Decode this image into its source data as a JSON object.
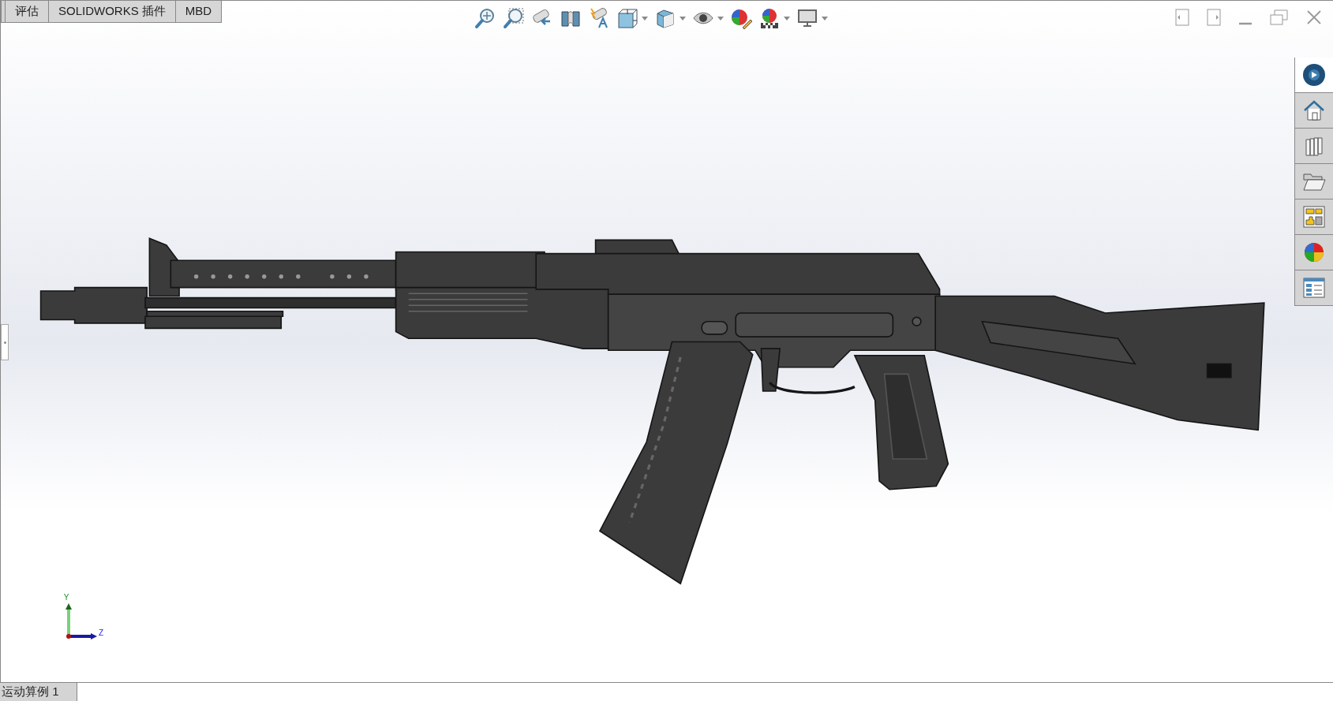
{
  "command_tabs": [
    {
      "label": "评估"
    },
    {
      "label": "SOLIDWORKS 插件"
    },
    {
      "label": "MBD"
    }
  ],
  "task_pane": {
    "tabs": [
      {
        "kind": "resources",
        "selected": true
      },
      {
        "kind": "home",
        "selected": false
      },
      {
        "kind": "library",
        "selected": false
      },
      {
        "kind": "folder",
        "selected": false
      },
      {
        "kind": "palette",
        "selected": false
      },
      {
        "kind": "appearance",
        "selected": false
      },
      {
        "kind": "properties",
        "selected": false
      }
    ]
  },
  "triad": {
    "y_label": "Y",
    "z_label": "Z"
  },
  "bottom_tabs": [
    {
      "label": "运动算例 1"
    }
  ]
}
